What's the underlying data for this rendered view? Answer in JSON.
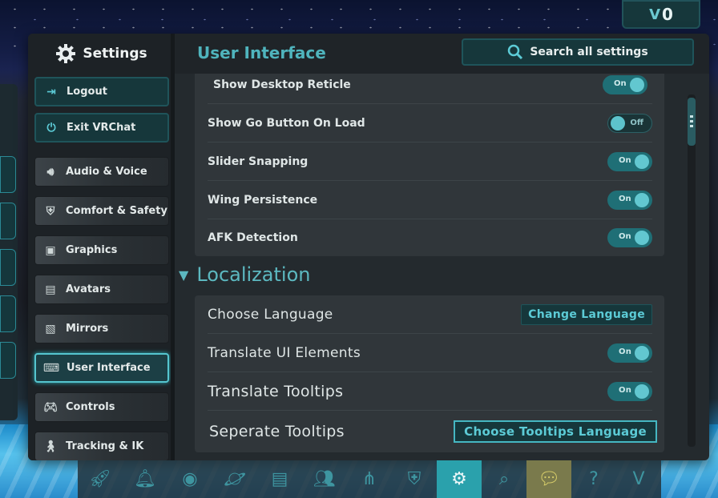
{
  "currency": {
    "symbol": "V",
    "amount": "0"
  },
  "sidebar": {
    "title": "Settings",
    "utility": [
      {
        "label": "Logout",
        "icon": "logout-icon"
      },
      {
        "label": "Exit VRChat",
        "icon": "power-icon"
      }
    ],
    "items": [
      {
        "label": "Audio & Voice",
        "icon": "speaker-icon"
      },
      {
        "label": "Comfort & Safety",
        "icon": "shield-icon"
      },
      {
        "label": "Graphics",
        "icon": "image-icon"
      },
      {
        "label": "Avatars",
        "icon": "avatar-book-icon"
      },
      {
        "label": "Mirrors",
        "icon": "mirror-icon"
      },
      {
        "label": "User Interface",
        "icon": "keyboard-icon",
        "active": true
      },
      {
        "label": "Controls",
        "icon": "gamepad-icon"
      },
      {
        "label": "Tracking & IK",
        "icon": "figure-icon"
      }
    ]
  },
  "header": {
    "title": "User Interface",
    "search_label": "Search all settings"
  },
  "settings": [
    {
      "label": "Show Desktop Reticle",
      "state": "On"
    },
    {
      "label": "Show Go Button On Load",
      "state": "Off"
    },
    {
      "label": "Slider Snapping",
      "state": "On"
    },
    {
      "label": "Wing Persistence",
      "state": "On"
    },
    {
      "label": "AFK Detection",
      "state": "On"
    }
  ],
  "localization": {
    "title": "Localization",
    "rows": [
      {
        "label": "Choose Language",
        "button": "Change Language"
      },
      {
        "label": "Translate UI Elements",
        "state": "On"
      },
      {
        "label": "Translate Tooltips",
        "state": "On"
      },
      {
        "label": "Seperate Tooltips",
        "button": "Choose Tooltips Language"
      }
    ]
  },
  "dock": [
    "rocket-icon",
    "bell-icon",
    "user-icon",
    "planet-icon",
    "avatar-icon",
    "group-icon",
    "network-icon",
    "shield-icon",
    "gear-icon",
    "search-icon",
    "chat-plus-icon",
    "help-icon",
    "vrchat-logo-icon"
  ],
  "colors": {
    "accent": "#5ccbd6",
    "panel": "#30363a",
    "active_border": "#55c5cf"
  }
}
